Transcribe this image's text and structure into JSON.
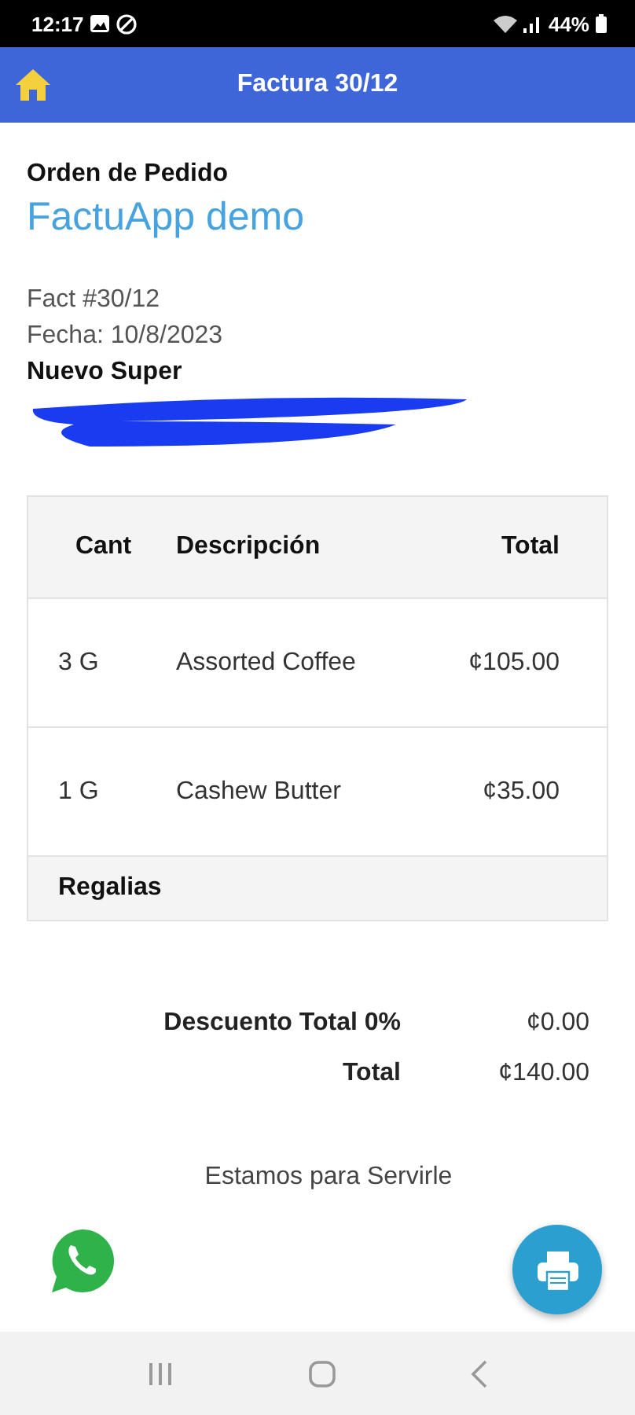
{
  "status_bar": {
    "time": "12:17",
    "battery": "44%"
  },
  "app_bar": {
    "title": "Factura 30/12"
  },
  "order": {
    "heading": "Orden de Pedido",
    "company": "FactuApp demo",
    "invoice_number": "Fact #30/12",
    "date": "Fecha: 10/8/2023",
    "client": "Nuevo Super",
    "redacted": true
  },
  "table": {
    "columns": [
      "Cant",
      "Descripción",
      "Total"
    ],
    "rows": [
      {
        "quantity": "3 G",
        "description": "Assorted Coffee",
        "total": "¢105.00"
      },
      {
        "quantity": "1 G",
        "description": "Cashew Butter",
        "total": "¢35.00"
      }
    ],
    "footer": "Regalias"
  },
  "totals": [
    {
      "label": "Descuento Total 0%",
      "value": "¢0.00"
    },
    {
      "label": "Total",
      "value": "¢140.00"
    }
  ],
  "footer_message": "Estamos para Servirle"
}
